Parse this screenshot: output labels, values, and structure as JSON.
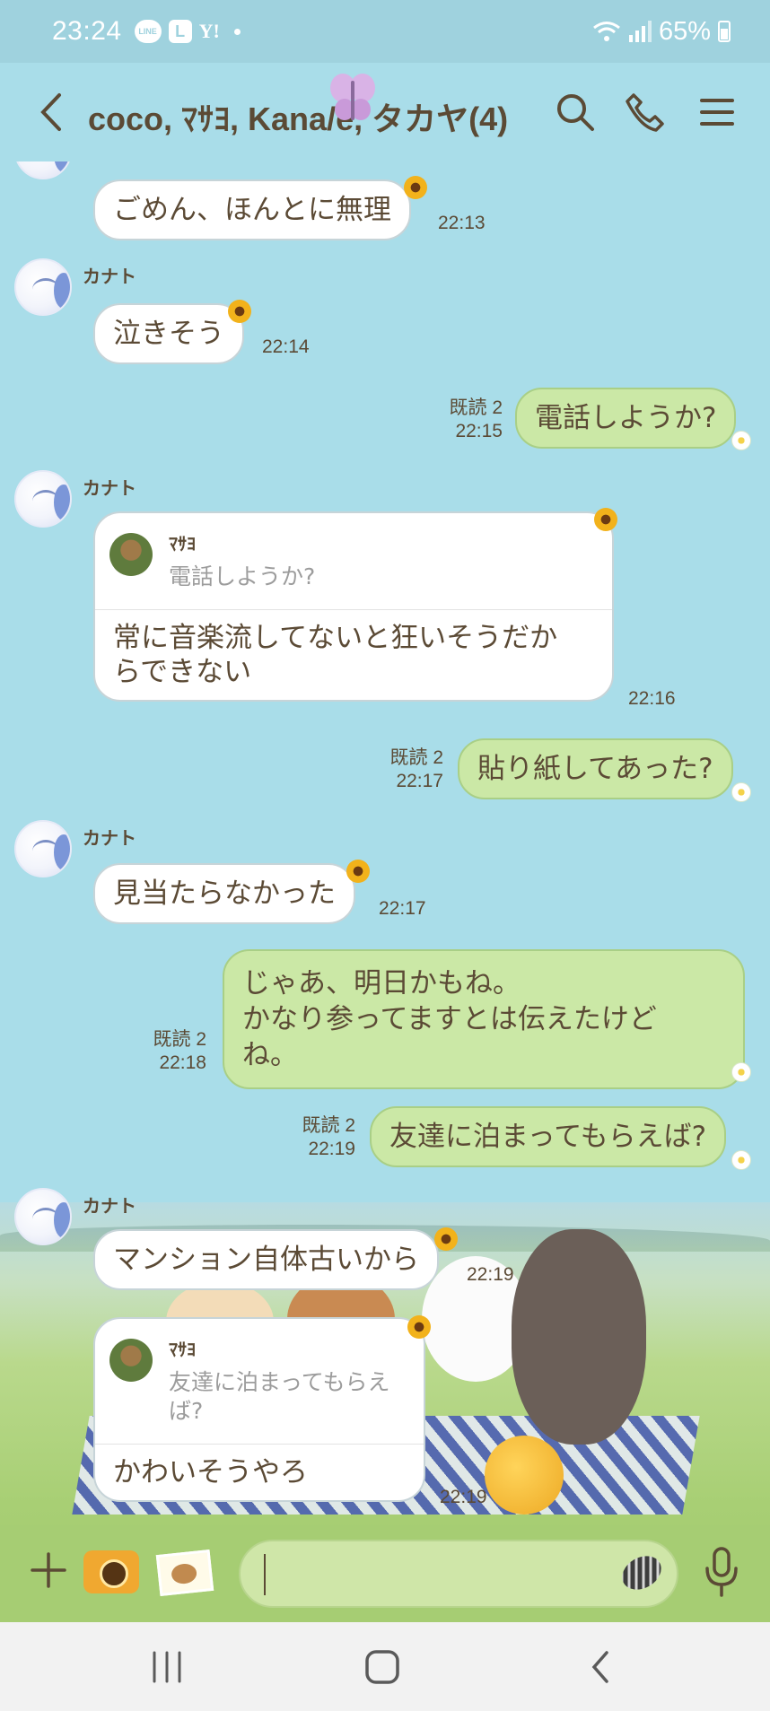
{
  "status_bar": {
    "time": "23:24",
    "notif_icons": [
      "line-icon",
      "l-icon",
      "yahoo-icon"
    ],
    "line_text": "LINE",
    "l_text": "L",
    "yahoo_text": "Y!",
    "battery": "65%"
  },
  "header": {
    "title": "coco, ﾏｻﾖ, Kana/e, タカヤ(4)"
  },
  "messages": [
    {
      "text": "ごめん、ほんとに無理",
      "time": "22:13"
    },
    {
      "sender": "カナト",
      "text": "泣きそう",
      "time": "22:14"
    },
    {
      "read": "既読 2",
      "text": "電話しようか?",
      "time": "22:15"
    },
    {
      "sender": "カナト",
      "quote_name": "ﾏｻﾖ",
      "quote_text": "電話しようか?",
      "text": "常に音楽流してないと狂いそうだか\nらできない",
      "time": "22:16"
    },
    {
      "read": "既読 2",
      "text": "貼り紙してあった?",
      "time": "22:17"
    },
    {
      "sender": "カナト",
      "text": "見当たらなかった",
      "time": "22:17"
    },
    {
      "read": "既読 2",
      "text": "じゃあ、明日かもね。\nかなり参ってますとは伝えたけど\nね。",
      "time": "22:18"
    },
    {
      "read": "既読 2",
      "text": "友達に泊まってもらえば?",
      "time": "22:19"
    },
    {
      "sender": "カナト",
      "text": "マンション自体古いから",
      "time": "22:19"
    },
    {
      "quote_name": "ﾏｻﾖ",
      "quote_text": "友達に泊まってもらえ\nば?",
      "text": "かわいそうやろ",
      "time": "22:19"
    }
  ],
  "input": {
    "value": ""
  },
  "colors": {
    "accent_mine": "#cbe8a6",
    "text": "#5b4a35",
    "sky": "#a9dde9"
  }
}
